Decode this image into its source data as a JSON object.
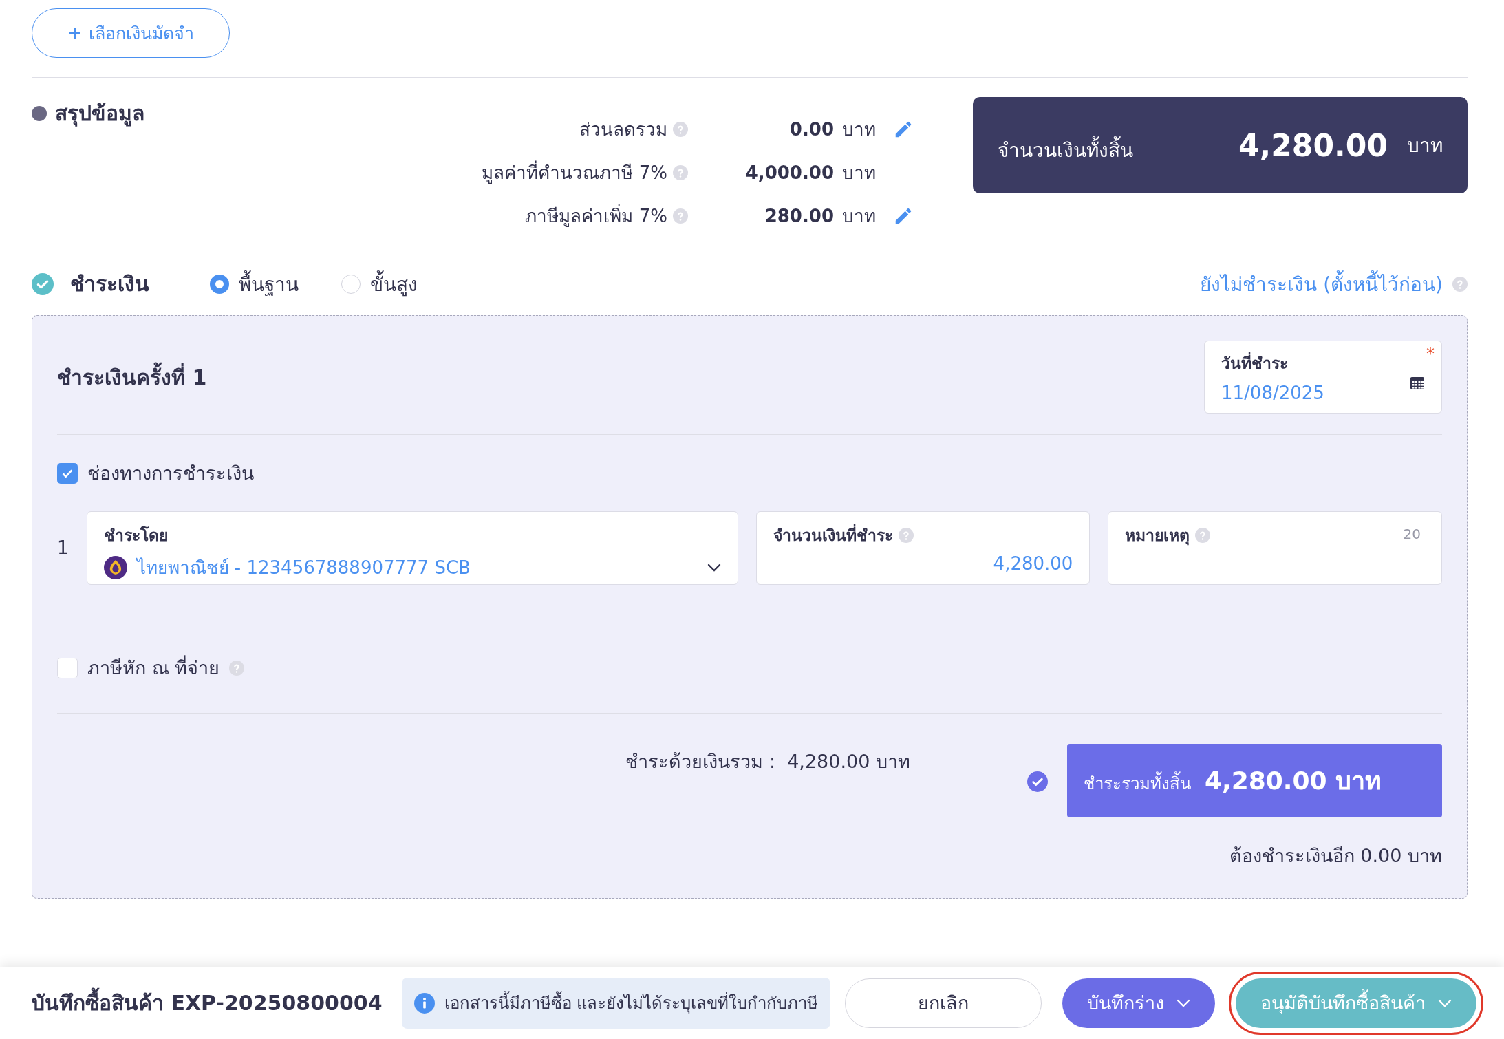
{
  "deposit_button": {
    "label": "เลือกเงินมัดจำ"
  },
  "summary": {
    "title": "สรุปข้อมูล",
    "rows": [
      {
        "label": "ส่วนลดรวม",
        "value": "0.00",
        "unit": "บาท",
        "editable": true
      },
      {
        "label": "มูลค่าที่คำนวณภาษี 7%",
        "value": "4,000.00",
        "unit": "บาท",
        "editable": false
      },
      {
        "label": "ภาษีมูลค่าเพิ่ม 7%",
        "value": "280.00",
        "unit": "บาท",
        "editable": true
      }
    ],
    "total": {
      "label": "จำนวนเงินทั้งสิ้น",
      "value": "4,280.00",
      "unit": "บาท"
    }
  },
  "payment": {
    "title": "ชำระเงิน",
    "done": true,
    "modes": [
      {
        "label": "พื้นฐาน",
        "selected": true
      },
      {
        "label": "ขั้นสูง",
        "selected": false
      }
    ],
    "unpaid_link": "ยังไม่ชำระเงิน (ตั้งหนี้ไว้ก่อน)",
    "installment": {
      "title": "ชำระเงินครั้งที่ 1",
      "date_field": {
        "label": "วันที่ชำระ",
        "value": "11/08/2025",
        "required": true,
        "required_mark": "*"
      },
      "channels": {
        "label": "ช่องทางการชำระเงิน",
        "checked": true,
        "rows": [
          {
            "number": "1",
            "method": {
              "label": "ชำระโดย",
              "value": "ไทยพาณิชย์ - 1234567888907777 SCB"
            },
            "amount": {
              "label": "จำนวนเงินที่ชำระ",
              "value": "4,280.00"
            },
            "note": {
              "label": "หมายเหตุ",
              "counter": "20"
            }
          }
        ]
      },
      "withholding": {
        "label": "ภาษีหัก ณ ที่จ่าย",
        "checked": false
      },
      "paid_summary": "ชำระด้วยเงินรวม :  4,280.00 บาท",
      "total": {
        "label": "ชำระรวมทั้งสิ้น",
        "value": "4,280.00 บาท",
        "confirmed": true
      },
      "remaining": "ต้องชำระเงินอีก 0.00 บาท"
    }
  },
  "footer": {
    "title": "บันทึกซื้อสินค้า EXP-20250800004",
    "notice": "เอกสารนี้มีภาษีซื้อ และยังไม่ได้ระบุเลขที่ใบกำกับภาษี",
    "buttons": [
      {
        "kind": "cancel",
        "label": "ยกเลิก",
        "dropdown": false,
        "highlighted": false
      },
      {
        "kind": "draft",
        "label": "บันทึกร่าง",
        "dropdown": true,
        "highlighted": false
      },
      {
        "kind": "approve",
        "label": "อนุมัติบันทึกซื้อสินค้า",
        "dropdown": true,
        "highlighted": true
      }
    ]
  }
}
